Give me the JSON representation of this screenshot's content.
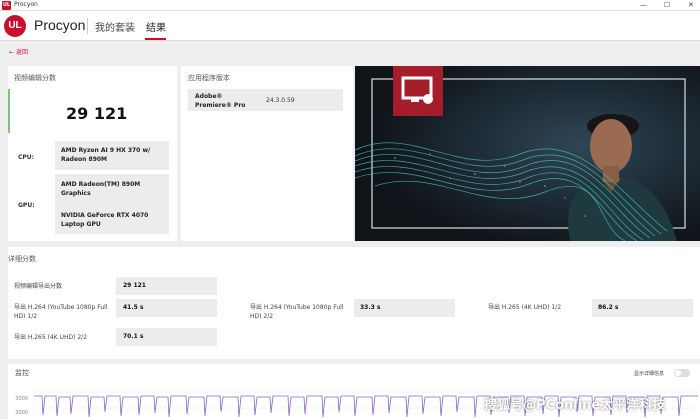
{
  "titlebar": {
    "logo": "UL",
    "title": "Procyon",
    "controls": [
      "—",
      "☐",
      "✕"
    ]
  },
  "header": {
    "logo": "UL",
    "app_name": "Procyon",
    "nav": [
      {
        "label": "我的套装"
      },
      {
        "label": "结果"
      }
    ]
  },
  "back_label": "返回",
  "score_section": {
    "title": "视频编辑分数",
    "score": "29 121",
    "cpu_label": "CPU:",
    "cpu_value": "AMD Ryzen AI 9 HX 370 w/ Radeon 890M",
    "gpu_label": "GPU:",
    "gpu_values": [
      "AMD Radeon(TM) 890M Graphics",
      "NVIDIA GeForce RTX 4070 Laptop GPU"
    ]
  },
  "app_version": {
    "title": "应用程序版本",
    "app_name": "Adobe® Premiere® Pro",
    "version": "24.3.0.59"
  },
  "details": {
    "title": "详细分数",
    "export_score_label": "视频编辑导出分数",
    "export_score_value": "29 121",
    "items": [
      {
        "label": "导出 H.264 (YouTube 1080p Full HD) 1/2",
        "value": "41.5 s"
      },
      {
        "label": "导出 H.264 (YouTube 1080p Full HD) 2/2",
        "value": "33.3 s"
      },
      {
        "label": "导出 H.265 (4K UHD) 1/2",
        "value": "86.2 s"
      },
      {
        "label": "导出 H.265 (4K UHD) 2/2",
        "value": "70.1 s"
      }
    ]
  },
  "monitoring": {
    "title": "监控",
    "toggle_label": "显示详细信息",
    "y_labels": [
      "3000",
      "2000"
    ]
  },
  "watermark": "搜狐号@PConline太平洋科技"
}
